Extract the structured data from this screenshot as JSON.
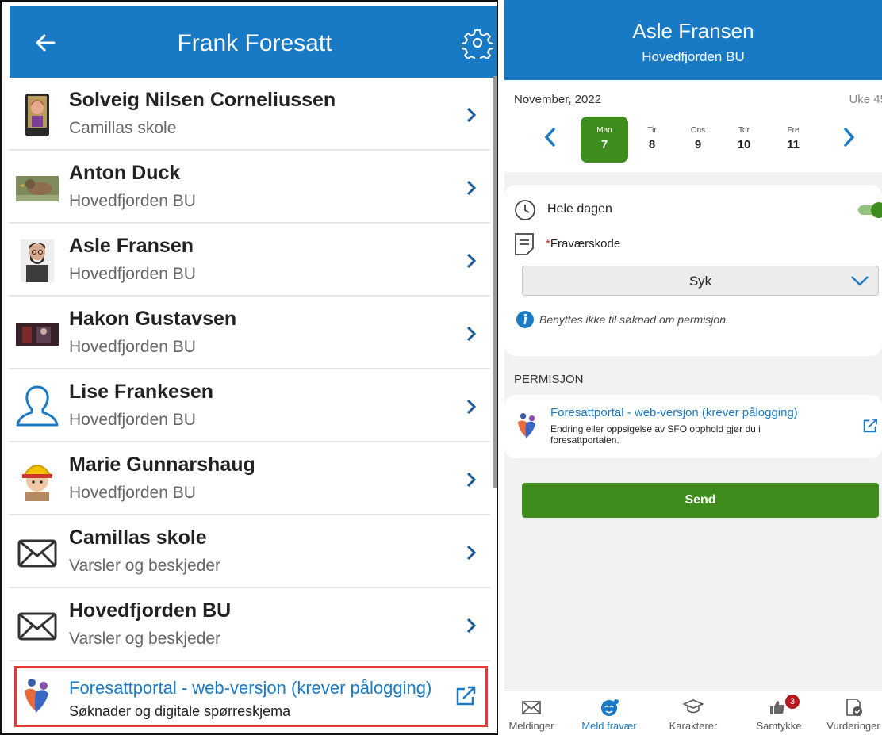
{
  "left": {
    "header": {
      "title": "Frank Foresatt"
    },
    "contacts": [
      {
        "name": "Solveig Nilsen Corneliussen",
        "subtitle": "Camillas skole",
        "avatar": "cartoon-avatar"
      },
      {
        "name": "Anton Duck",
        "subtitle": "Hovedfjorden BU",
        "avatar": "duck-photo"
      },
      {
        "name": "Asle Fransen",
        "subtitle": "Hovedfjorden BU",
        "avatar": "bearded-man-avatar"
      },
      {
        "name": "Hakon Gustavsen",
        "subtitle": "Hovedfjorden BU",
        "avatar": "photo-avatar"
      },
      {
        "name": "Lise Frankesen",
        "subtitle": "Hovedfjorden BU",
        "avatar": "person-outline-icon"
      },
      {
        "name": "Marie Gunnarshaug",
        "subtitle": "Hovedfjorden BU",
        "avatar": "hardhat-avatar"
      },
      {
        "name": "Camillas skole",
        "subtitle": "Varsler og beskjeder",
        "avatar": "envelope-icon"
      },
      {
        "name": "Hovedfjorden BU",
        "subtitle": "Varsler og beskjeder",
        "avatar": "envelope-icon"
      }
    ],
    "portal": {
      "title": "Foresattportal - web-versjon (krever pålogging)",
      "subtitle": "Søknader og digitale spørreskjema"
    }
  },
  "right": {
    "header": {
      "name": "Asle Fransen",
      "school": "Hovedfjorden BU"
    },
    "calendar": {
      "month": "November, 2022",
      "week": "Uke 45",
      "days": [
        {
          "name": "Man",
          "date": "7",
          "selected": true
        },
        {
          "name": "Tir",
          "date": "8",
          "selected": false
        },
        {
          "name": "Ons",
          "date": "9",
          "selected": false
        },
        {
          "name": "Tor",
          "date": "10",
          "selected": false
        },
        {
          "name": "Fre",
          "date": "11",
          "selected": false
        }
      ]
    },
    "form": {
      "all_day_label": "Hele dagen",
      "all_day_on": true,
      "required_mark": "*",
      "code_label": "Fraværskode",
      "code_value": "Syk",
      "info_text": "Benyttes ikke til søknad om permisjon."
    },
    "permission": {
      "heading": "PERMISJON",
      "title": "Foresattportal - web-versjon (krever pålogging)",
      "subtitle": "Endring eller oppsigelse av SFO opphold gjør du i foresattportalen."
    },
    "send_label": "Send",
    "nav": [
      {
        "label": "Meldinger",
        "icon": "envelope-icon",
        "active": false
      },
      {
        "label": "Meld fravær",
        "icon": "absence-icon",
        "active": true
      },
      {
        "label": "Karakterer",
        "icon": "graduation-cap-icon",
        "active": false
      },
      {
        "label": "Samtykke",
        "icon": "thumbs-icon",
        "active": false,
        "badge": "3"
      },
      {
        "label": "Vurderinger",
        "icon": "evaluation-icon",
        "active": false
      }
    ]
  },
  "colors": {
    "header_blue": "#1879c4",
    "accent_green": "#3d8c1c",
    "link_blue": "#1a7ac6",
    "highlight_red": "#e03a3a",
    "badge_red": "#b3171d"
  }
}
